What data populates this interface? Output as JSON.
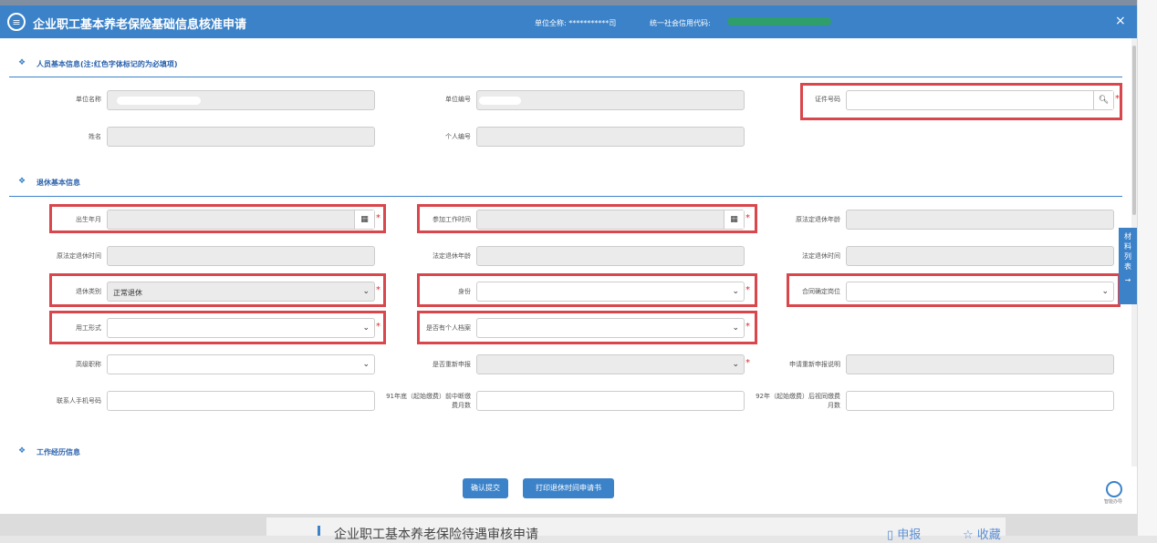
{
  "header": {
    "title": "企业职工基本养老保险基础信息核准申请",
    "unit_full_name": "单位全称: ***********司",
    "credit_code_label": "统一社会信用代码:",
    "close": "×"
  },
  "sections": {
    "person": "人员基本信息(注:红色字体标记的为必填项)",
    "retire": "退休基本信息",
    "work": "工作经历信息"
  },
  "fields": {
    "unit_name": "单位名称",
    "unit_no": "单位编号",
    "id_no": "证件号码",
    "name": "姓名",
    "personal_no": "个人编号",
    "birth": "出生年月",
    "work_start": "参加工作时间",
    "legal_age": "原法定退休年龄",
    "orig_retire_time": "原法定退休时间",
    "legal_retire_age": "法定退休年龄",
    "legal_retire_time": "法定退休时间",
    "retire_type": "退休类别",
    "retire_type_value": "正常退休",
    "identity": "身份",
    "contract_post": "合同确定岗位",
    "employment_form": "用工形式",
    "has_archive": "是否有个人档案",
    "senior_title": "高级职称",
    "resubmit": "是否重新申报",
    "resubmit_desc": "申请重新申报说明",
    "phone": "联系人手机号码",
    "months_91": "91年底（起始缴费）前中断缴费月数",
    "months_92": "92年（起始缴费）后视同缴费月数"
  },
  "buttons": {
    "confirm": "确认提交",
    "print": "打印退休时间申请书"
  },
  "side_tab": "材料列表",
  "help_text": "智能办导",
  "below": {
    "title": "企业职工基本养老保险待遇审核申请",
    "report": "申报",
    "favorite": "收藏"
  },
  "colors": {
    "primary": "#3b82c9",
    "highlight": "#d9464b",
    "required": "#d23030"
  }
}
